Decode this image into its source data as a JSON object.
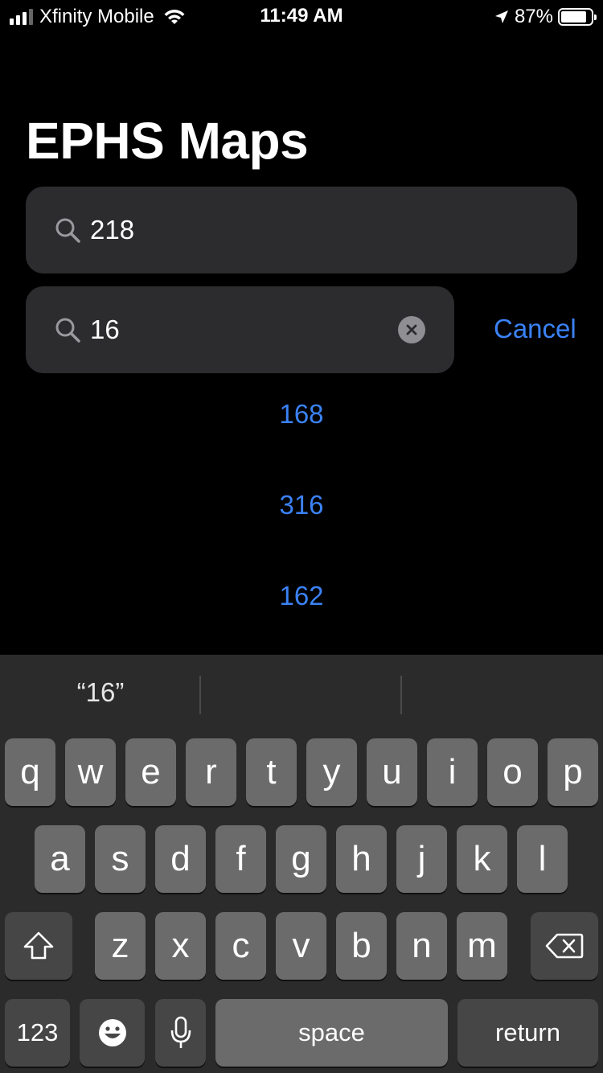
{
  "status_bar": {
    "carrier": "Xfinity Mobile",
    "time": "11:49 AM",
    "battery_percent": "87%",
    "battery_level": 0.87,
    "signal_bars": 3
  },
  "app": {
    "title": "EPHS Maps"
  },
  "search_from": {
    "value": "218"
  },
  "search_to": {
    "value": "16",
    "cancel_label": "Cancel"
  },
  "results": [
    "168",
    "316",
    "162"
  ],
  "keyboard": {
    "prediction": "“16”",
    "row1": [
      "q",
      "w",
      "e",
      "r",
      "t",
      "y",
      "u",
      "i",
      "o",
      "p"
    ],
    "row2": [
      "a",
      "s",
      "d",
      "f",
      "g",
      "h",
      "j",
      "k",
      "l"
    ],
    "row3": [
      "z",
      "x",
      "c",
      "v",
      "b",
      "n",
      "m"
    ],
    "numbers_label": "123",
    "space_label": "space",
    "return_label": "return"
  },
  "colors": {
    "accent": "#3b82f6",
    "field_bg": "#2c2c2e",
    "keyboard_bg": "#2b2b2b",
    "key_bg": "#6b6b6b",
    "key_dark_bg": "#464646"
  },
  "icons": [
    "signal-icon",
    "wifi-icon",
    "location-arrow-icon",
    "battery-icon",
    "search-icon",
    "clear-icon",
    "shift-icon",
    "backspace-icon",
    "emoji-icon",
    "microphone-icon"
  ]
}
